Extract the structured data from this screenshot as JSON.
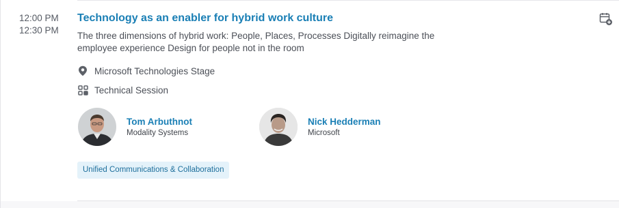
{
  "session": {
    "start_time": "12:00 PM",
    "end_time": "12:30 PM",
    "title": "Technology as an enabler for hybrid work culture",
    "description": "The three dimensions of hybrid work: People, Places, Processes Digitally reimagine the employee experience Design for people not in the room",
    "location": "Microsoft Technologies Stage",
    "session_type": "Technical Session",
    "tag": "Unified Communications & Collaboration"
  },
  "speakers": [
    {
      "name": "Tom Arbuthnot",
      "company": "Modality Systems"
    },
    {
      "name": "Nick Hedderman",
      "company": "Microsoft"
    }
  ],
  "icons": {
    "location": "map-pin-icon",
    "session_type": "grid-icon",
    "calendar": "calendar-add-icon"
  },
  "colors": {
    "accent": "#1a7fb5",
    "tag_background": "#e4f2fa",
    "text": "#4b4f57"
  }
}
